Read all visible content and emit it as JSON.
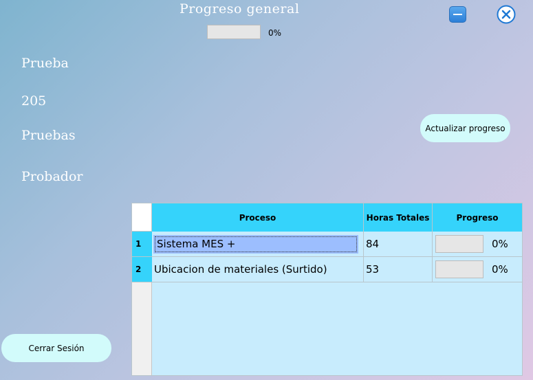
{
  "header": {
    "title": "Progreso general",
    "overall_progress_percent": 0,
    "overall_progress_label": "0%"
  },
  "info": {
    "line1": "Prueba",
    "line2": "205",
    "line3": "Pruebas",
    "line4": "Probador"
  },
  "buttons": {
    "update": "Actualizar progreso",
    "logout": "Cerrar Sesión"
  },
  "table": {
    "columns": [
      "Proceso",
      "Horas Totales",
      "Progreso"
    ],
    "rows": [
      {
        "num": "1",
        "proceso": "Sistema MES +",
        "horas": "84",
        "progress_percent": 0,
        "progress_label": "0%"
      },
      {
        "num": "2",
        "proceso": "Ubicacion de materiales (Surtido)",
        "horas": "53",
        "progress_percent": 0,
        "progress_label": "0%"
      }
    ]
  },
  "colors": {
    "header_cyan": "#35d3fb",
    "grid_bg": "#c8ecfd",
    "selected_cell": "#9cbefe",
    "button_bg": "#d2fbfb"
  },
  "icons": {
    "minimize": "minimize-icon",
    "close": "close-icon"
  }
}
